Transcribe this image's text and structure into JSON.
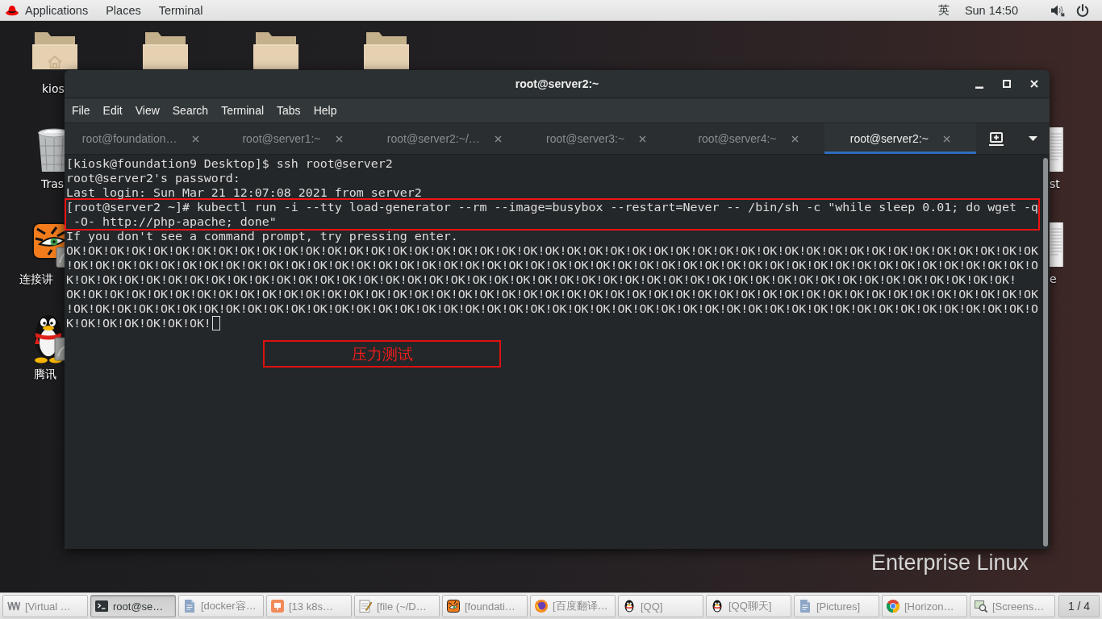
{
  "top_bar": {
    "menus": [
      "Applications",
      "Places",
      "Terminal"
    ],
    "input_method": "英",
    "clock": "Sun 14:50"
  },
  "desktop": {
    "icons": [
      {
        "kind": "home-folder",
        "label": "kios"
      },
      {
        "kind": "folder"
      },
      {
        "kind": "folder"
      },
      {
        "kind": "folder"
      },
      {
        "kind": "trash",
        "label": "Tras"
      },
      {
        "kind": "tiger-launcher",
        "label": "连接讲"
      },
      {
        "kind": "penguin-launcher",
        "label": "腾讯"
      },
      {
        "kind": "document",
        "label": "st"
      },
      {
        "kind": "document",
        "label": "e"
      }
    ],
    "wallpaper_text": "Enterprise Linux"
  },
  "terminal": {
    "title": "root@server2:~",
    "menu": [
      "File",
      "Edit",
      "View",
      "Search",
      "Terminal",
      "Tabs",
      "Help"
    ],
    "tabs": [
      {
        "label": "root@foundation…",
        "selected": false
      },
      {
        "label": "root@server1:~",
        "selected": false
      },
      {
        "label": "root@server2:~/…",
        "selected": false
      },
      {
        "label": "root@server3:~",
        "selected": false
      },
      {
        "label": "root@server4:~",
        "selected": false
      },
      {
        "label": "root@server2:~",
        "selected": true
      }
    ],
    "lines": [
      {
        "text": "[kiosk@foundation9 Desktop]$ ssh root@server2",
        "highlighted": false
      },
      {
        "text": "root@server2's password:",
        "highlighted": false
      },
      {
        "text": "Last login: Sun Mar 21 12:07:08 2021 from server2",
        "highlighted": false
      },
      {
        "text": "[root@server2 ~]# kubectl run -i --tty load-generator --rm --image=busybox --restart=Never -- /bin/sh -c \"while sleep 0.01; do wget -q",
        "highlighted": true
      },
      {
        "text": " -O- http://php-apache; done\"",
        "highlighted": true
      },
      {
        "text": "If you don't see a command prompt, try pressing enter.",
        "highlighted": false
      },
      {
        "text": "OK!OK!OK!OK!OK!OK!OK!OK!OK!OK!OK!OK!OK!OK!OK!OK!OK!OK!OK!OK!OK!OK!OK!OK!OK!OK!OK!OK!OK!OK!OK!OK!OK!OK!OK!OK!OK!OK!OK!OK!OK!OK!OK!OK!OK",
        "highlighted": false
      },
      {
        "text": "!OK!OK!OK!OK!OK!OK!OK!OK!OK!OK!OK!OK!OK!OK!OK!OK!OK!OK!OK!OK!OK!OK!OK!OK!OK!OK!OK!OK!OK!OK!OK!OK!OK!OK!OK!OK!OK!OK!OK!OK!OK!OK!OK!OK!O",
        "highlighted": false
      },
      {
        "text": "K!OK!OK!OK!OK!OK!OK!OK!OK!OK!OK!OK!OK!OK!OK!OK!OK!OK!OK!OK!OK!OK!OK!OK!OK!OK!OK!OK!OK!OK!OK!OK!OK!OK!OK!OK!OK!OK!OK!OK!OK!OK!OK!OK!",
        "highlighted": false
      },
      {
        "text": "OK!OK!OK!OK!OK!OK!OK!OK!OK!OK!OK!OK!OK!OK!OK!OK!OK!OK!OK!OK!OK!OK!OK!OK!OK!OK!OK!OK!OK!OK!OK!OK!OK!OK!OK!OK!OK!OK!OK!OK!OK!OK!OK!OK!OK",
        "highlighted": false
      },
      {
        "text": "!OK!OK!OK!OK!OK!OK!OK!OK!OK!OK!OK!OK!OK!OK!OK!OK!OK!OK!OK!OK!OK!OK!OK!OK!OK!OK!OK!OK!OK!OK!OK!OK!OK!OK!OK!OK!OK!OK!OK!OK!OK!OK!OK!OK!O",
        "highlighted": false
      },
      {
        "text": "K!OK!OK!OK!OK!OK!OK!",
        "highlighted": false
      }
    ],
    "annotation": "压力测试"
  },
  "taskbar": {
    "windows": [
      {
        "kind": "zigzag",
        "label": "[Virtual …",
        "selected": false,
        "minimized": true
      },
      {
        "kind": "terminal",
        "label": "root@se…",
        "selected": true,
        "minimized": false
      },
      {
        "kind": "document",
        "label": "[docker容…",
        "selected": false,
        "minimized": true
      },
      {
        "kind": "slides",
        "label": "[13 k8s…",
        "selected": false,
        "minimized": true
      },
      {
        "kind": "notepad",
        "label": "[file (~/D…",
        "selected": false,
        "minimized": true
      },
      {
        "kind": "tiger",
        "label": "[foundati…",
        "selected": false,
        "minimized": true
      },
      {
        "kind": "fox-browser",
        "label": "[百度翻译…",
        "selected": false,
        "minimized": true
      },
      {
        "kind": "penguin",
        "label": "[QQ]",
        "selected": false,
        "minimized": true
      },
      {
        "kind": "penguin",
        "label": "[QQ聊天]",
        "selected": false,
        "minimized": true
      },
      {
        "kind": "document",
        "label": "[Pictures]",
        "selected": false,
        "minimized": true
      },
      {
        "kind": "wheel-browser",
        "label": "[Horizon…",
        "selected": false,
        "minimized": true
      },
      {
        "kind": "magnifier",
        "label": "[Screens…",
        "selected": false,
        "minimized": true
      }
    ],
    "workspace": "1 / 4"
  }
}
